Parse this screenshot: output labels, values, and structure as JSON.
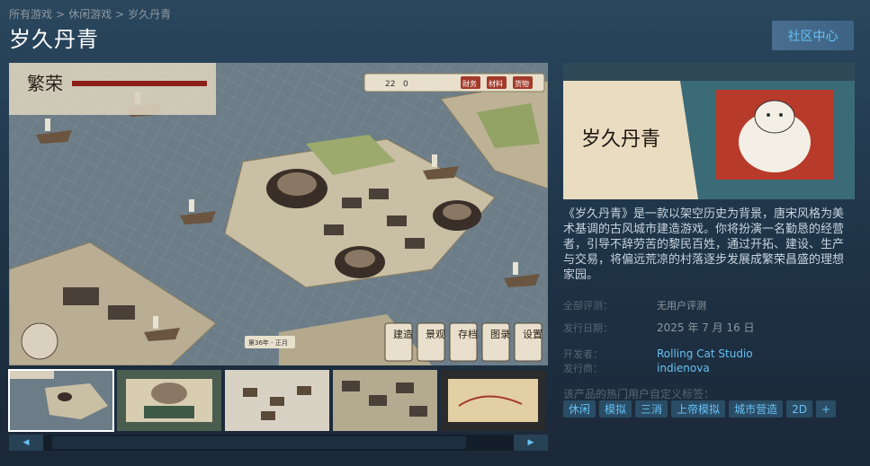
{
  "breadcrumb": [
    "所有游戏",
    "休闲游戏",
    "岁久丹青"
  ],
  "breadcrumb_sep": ">",
  "title": "岁久丹青",
  "community_button": "社区中心",
  "hud": {
    "logo_text": "繁荣",
    "resource_count": "22",
    "resource_zero": "0",
    "btn_finance": "财务",
    "btn_material": "材料",
    "btn_goods": "货物",
    "date_label": "第36年 - 正月",
    "menu": [
      "建造",
      "景观",
      "存档",
      "图录",
      "设置"
    ]
  },
  "capsule_logo": "岁久丹青",
  "description": "《岁久丹青》是一款以架空历史为背景，唐宋风格为美术基调的古风城市建造游戏。你将扮演一名勤恳的经营者，引导不辞劳苦的黎民百姓，通过开拓、建设、生产与交易，将偏远荒凉的村落逐步发展成繁荣昌盛的理想家园。",
  "reviews": {
    "label": "全部评测：",
    "value": "无用户评测"
  },
  "release": {
    "label": "发行日期：",
    "value": "2025 年 7 月 16 日"
  },
  "developer": {
    "label": "开发者：",
    "value": "Rolling Cat Studio"
  },
  "publisher": {
    "label": "发行商：",
    "value": "indienova"
  },
  "tags_label": "该产品的热门用户自定义标签：",
  "tags": [
    "休闲",
    "模拟",
    "三消",
    "上帝模拟",
    "城市营造",
    "2D",
    "+"
  ],
  "scroll": {
    "left": "◀",
    "right": "▶"
  },
  "colors": {
    "link": "#67c1f5",
    "bg_top": "#2a475e",
    "bg_bottom": "#1b2838"
  }
}
